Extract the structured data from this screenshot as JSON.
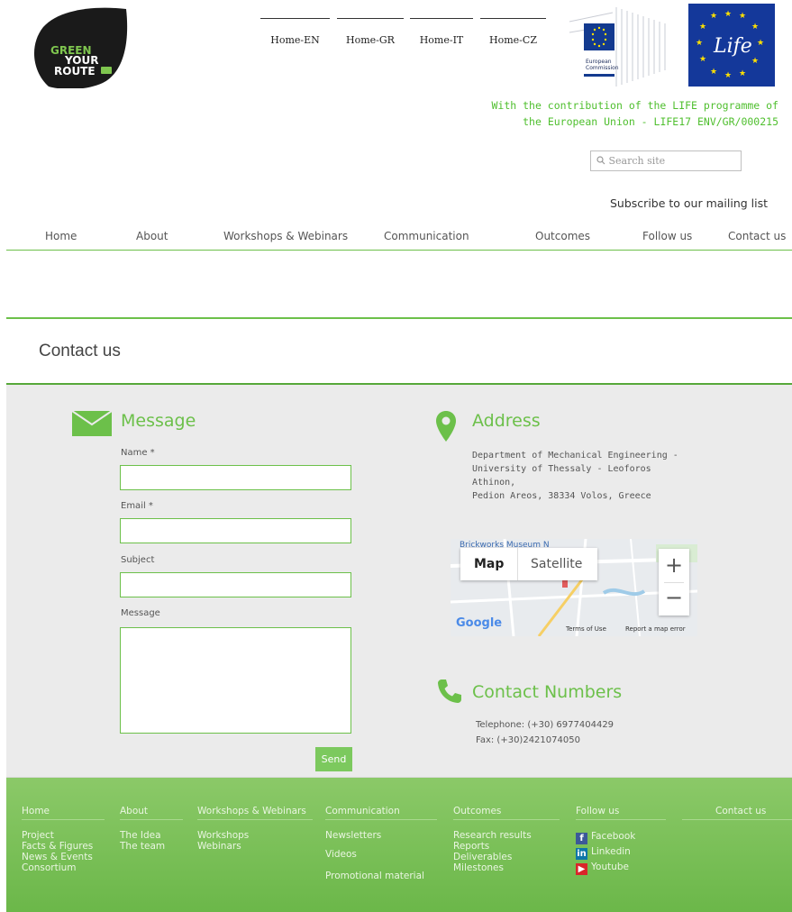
{
  "header": {
    "logo_text": [
      "GREEN",
      "YOUR",
      "ROUTE"
    ],
    "lang_links": [
      "Home-EN",
      "Home-GR",
      "Home-IT",
      "Home-CZ"
    ],
    "ec_text": [
      "European",
      "Commission"
    ],
    "life_text": "Life",
    "contribution": [
      "With the contribution of the LIFE programme of",
      "the European Union - LIFE17 ENV/GR/000215"
    ],
    "search_placeholder": "Search site",
    "subscribe": "Subscribe to our mailing list"
  },
  "nav": [
    "Home",
    "About",
    "Workshops & Webinars",
    "Communication",
    "Outcomes",
    "Follow us",
    "Contact us"
  ],
  "page_title": "Contact us",
  "message": {
    "title": "Message",
    "fields": [
      "Name *",
      "Email *",
      "Subject",
      "Message"
    ],
    "send": "Send"
  },
  "address": {
    "title": "Address",
    "lines": [
      "Department of Mechanical Engineering -",
      "University of Thessaly - Leoforos Athinon,",
      "Pedion Areos, 38334 Volos, Greece"
    ]
  },
  "map": {
    "label_top": "Brickworks Museum N",
    "map_button": "Map",
    "satellite_button": "Satellite",
    "zoom_in": "+",
    "zoom_out": "−",
    "google": "Google",
    "terms": "Terms of Use",
    "report": "Report a map error"
  },
  "contact_numbers": {
    "title": "Contact Numbers",
    "telephone": "Telephone: (+30) 6977404429",
    "fax": "Fax: (+30)2421074050"
  },
  "footer": {
    "columns": [
      {
        "head": "Home",
        "items": [
          "Project",
          "Facts & Figures",
          "News & Events",
          "Consortium"
        ]
      },
      {
        "head": "About",
        "items": [
          "The Idea",
          "The team"
        ]
      },
      {
        "head": "Workshops & Webinars",
        "items": [
          "Workshops",
          "Webinars"
        ]
      },
      {
        "head": "Communication",
        "items": [
          "Newsletters",
          "Videos",
          "Promotional material"
        ]
      },
      {
        "head": "Outcomes",
        "items": [
          "Research results",
          "Reports",
          "Deliverables",
          "Milestones"
        ]
      },
      {
        "head": "Follow us",
        "items": [
          "Facebook",
          "Linkedin",
          "Youtube"
        ]
      },
      {
        "head": "Contact us",
        "items": []
      }
    ]
  },
  "colors": {
    "accent_green": "#6cc04a",
    "footer_green": "#78be55",
    "text_gray": "#555555"
  },
  "icons": [
    "envelope-icon",
    "location-pin-icon",
    "phone-icon",
    "search-icon",
    "facebook-icon",
    "linkedin-icon",
    "youtube-icon"
  ]
}
